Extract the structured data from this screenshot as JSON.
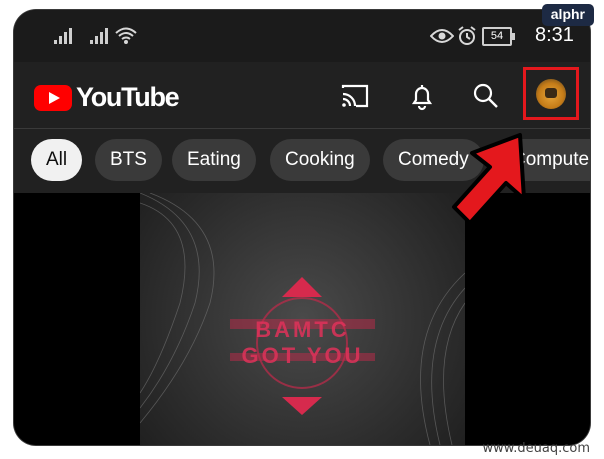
{
  "watermarks": {
    "brand": "alphr",
    "site": "www.deuaq.com"
  },
  "status_bar": {
    "battery": "54",
    "time": "8:31"
  },
  "app_bar": {
    "logo_text": "YouTube",
    "icons": [
      "cast-icon",
      "bell-icon",
      "search-icon"
    ],
    "avatar": "profile-avatar"
  },
  "chips": [
    "All",
    "BTS",
    "Eating",
    "Cooking",
    "Comedy",
    "Compute"
  ],
  "video": {
    "thumbnail_text_line1": "BAMTC",
    "thumbnail_text_line2": "GOT YOU"
  },
  "colors": {
    "accent_red": "#ff0000",
    "highlight_box": "#e4181d",
    "chip_bg": "#3a3a3a",
    "chip_active_bg": "#f1f1f1",
    "background": "#0f0f0f"
  }
}
